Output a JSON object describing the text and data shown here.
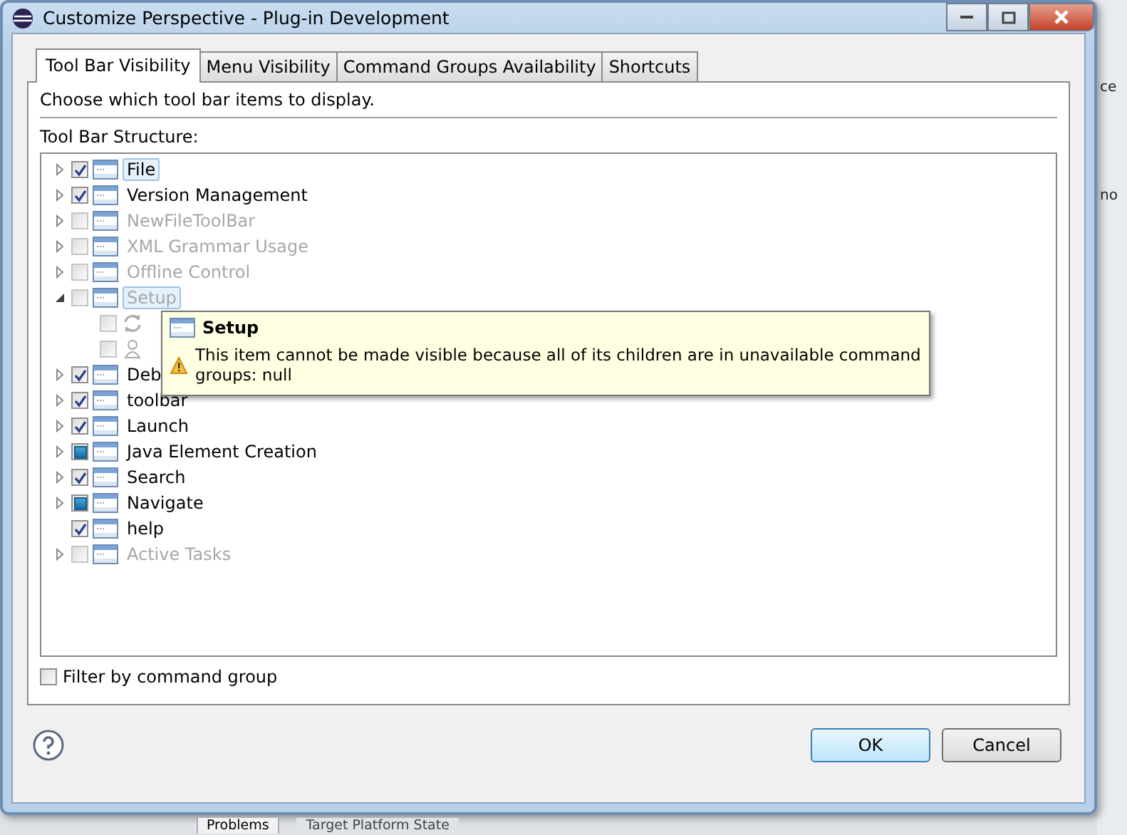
{
  "window": {
    "title": "Customize Perspective - Plug-in Development"
  },
  "tabs": [
    {
      "label": "Tool Bar Visibility",
      "selected": true
    },
    {
      "label": "Menu Visibility",
      "selected": false
    },
    {
      "label": "Command Groups Availability",
      "selected": false
    },
    {
      "label": "Shortcuts",
      "selected": false
    }
  ],
  "description": "Choose which tool bar items to display.",
  "tree_label": "Tool Bar Structure:",
  "tree": [
    {
      "label": "File",
      "checked": true,
      "grayed": false,
      "disabled": false,
      "expandable": true,
      "expanded": false,
      "selected": true
    },
    {
      "label": "Version Management",
      "checked": true,
      "grayed": false,
      "disabled": false,
      "expandable": true,
      "expanded": false,
      "selected": false
    },
    {
      "label": "NewFileToolBar",
      "checked": false,
      "grayed": false,
      "disabled": true,
      "expandable": true,
      "expanded": false,
      "selected": false
    },
    {
      "label": "XML Grammar Usage",
      "checked": false,
      "grayed": false,
      "disabled": true,
      "expandable": true,
      "expanded": false,
      "selected": false
    },
    {
      "label": "Offline Control",
      "checked": false,
      "grayed": false,
      "disabled": true,
      "expandable": true,
      "expanded": false,
      "selected": false
    },
    {
      "label": "Setup",
      "checked": false,
      "grayed": false,
      "disabled": true,
      "expandable": true,
      "expanded": true,
      "selected": true,
      "children": [
        {
          "kind": "sync",
          "checked": false
        },
        {
          "kind": "person",
          "checked": false
        }
      ]
    },
    {
      "label": "Deb",
      "checked": true,
      "grayed": false,
      "disabled": false,
      "expandable": true,
      "expanded": false,
      "selected": false
    },
    {
      "label": "toolbar",
      "checked": true,
      "grayed": false,
      "disabled": false,
      "expandable": true,
      "expanded": false,
      "selected": false
    },
    {
      "label": "Launch",
      "checked": true,
      "grayed": false,
      "disabled": false,
      "expandable": true,
      "expanded": false,
      "selected": false
    },
    {
      "label": "Java Element Creation",
      "checked": true,
      "grayed": true,
      "disabled": false,
      "expandable": true,
      "expanded": false,
      "selected": false
    },
    {
      "label": "Search",
      "checked": true,
      "grayed": false,
      "disabled": false,
      "expandable": true,
      "expanded": false,
      "selected": false
    },
    {
      "label": "Navigate",
      "checked": true,
      "grayed": true,
      "disabled": false,
      "expandable": true,
      "expanded": false,
      "selected": false
    },
    {
      "label": "help",
      "checked": true,
      "grayed": false,
      "disabled": false,
      "expandable": false,
      "expanded": false,
      "selected": false
    },
    {
      "label": "Active Tasks",
      "checked": false,
      "grayed": false,
      "disabled": true,
      "expandable": true,
      "expanded": false,
      "selected": false
    }
  ],
  "tooltip": {
    "title": "Setup",
    "message": "This item cannot be made visible because all of its children are in unavailable command groups: null"
  },
  "filter": {
    "label": "Filter by command group",
    "checked": false
  },
  "buttons": [
    {
      "label": "OK",
      "default": true
    },
    {
      "label": "Cancel",
      "default": false
    }
  ],
  "background": {
    "fragments": [
      "ce",
      "no"
    ],
    "tabs": [
      "Problems",
      "Target Platform State"
    ]
  }
}
